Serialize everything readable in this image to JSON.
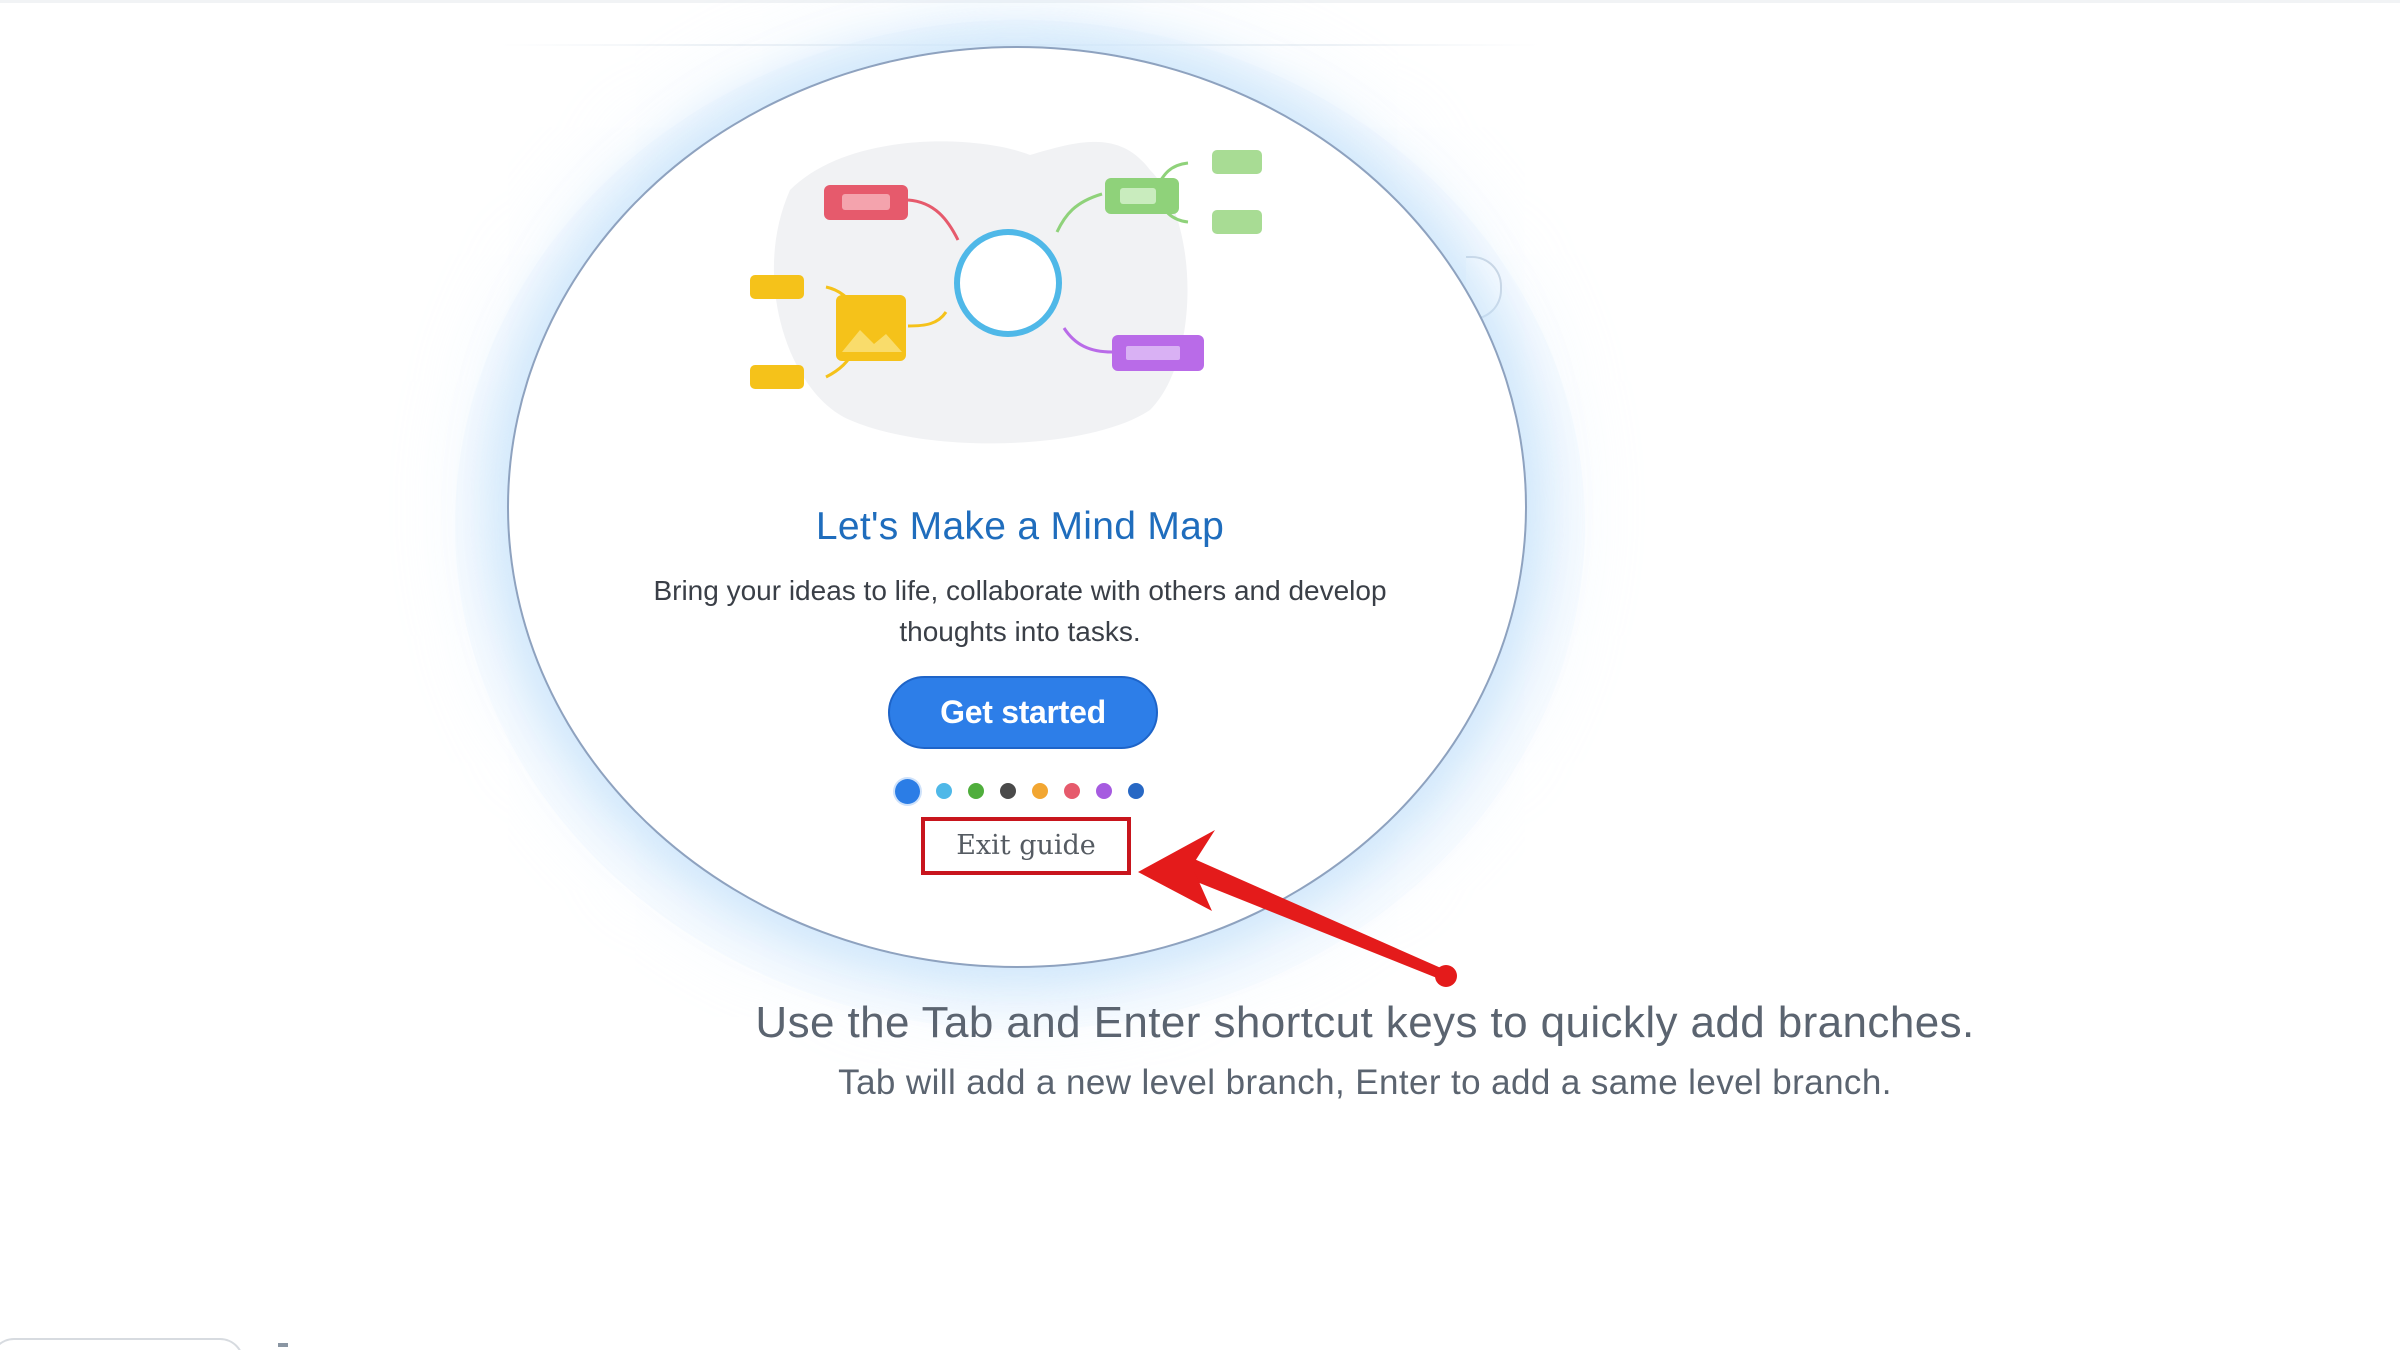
{
  "guide": {
    "title": "Let's Make a Mind Map",
    "subtitle": "Bring your ideas to life, collaborate with others and develop thoughts into tasks.",
    "get_started_label": "Get started",
    "exit_guide_label": "Exit guide",
    "pager_dots": [
      {
        "color": "#2b7de6",
        "active": true
      },
      {
        "color": "#4fb8e8",
        "active": false
      },
      {
        "color": "#4fae3c",
        "active": false
      },
      {
        "color": "#4a4a4a",
        "active": false
      },
      {
        "color": "#f2a632",
        "active": false
      },
      {
        "color": "#e65a6c",
        "active": false
      },
      {
        "color": "#a65be0",
        "active": false
      },
      {
        "color": "#2868c4",
        "active": false
      }
    ]
  },
  "hint": {
    "main": "Use the Tab and Enter shortcut keys to quickly add branches.",
    "sub": "Tab will add a new level branch, Enter to add a same level branch."
  },
  "annotation": {
    "highlight_color": "#c8151d",
    "arrow_color": "#e41b1b"
  },
  "illustration": {
    "colors": {
      "center": "#4fb8e8",
      "red": "#e65a6c",
      "green": "#8fd27a",
      "yellow": "#f5c21a",
      "purple": "#b96be8"
    }
  }
}
